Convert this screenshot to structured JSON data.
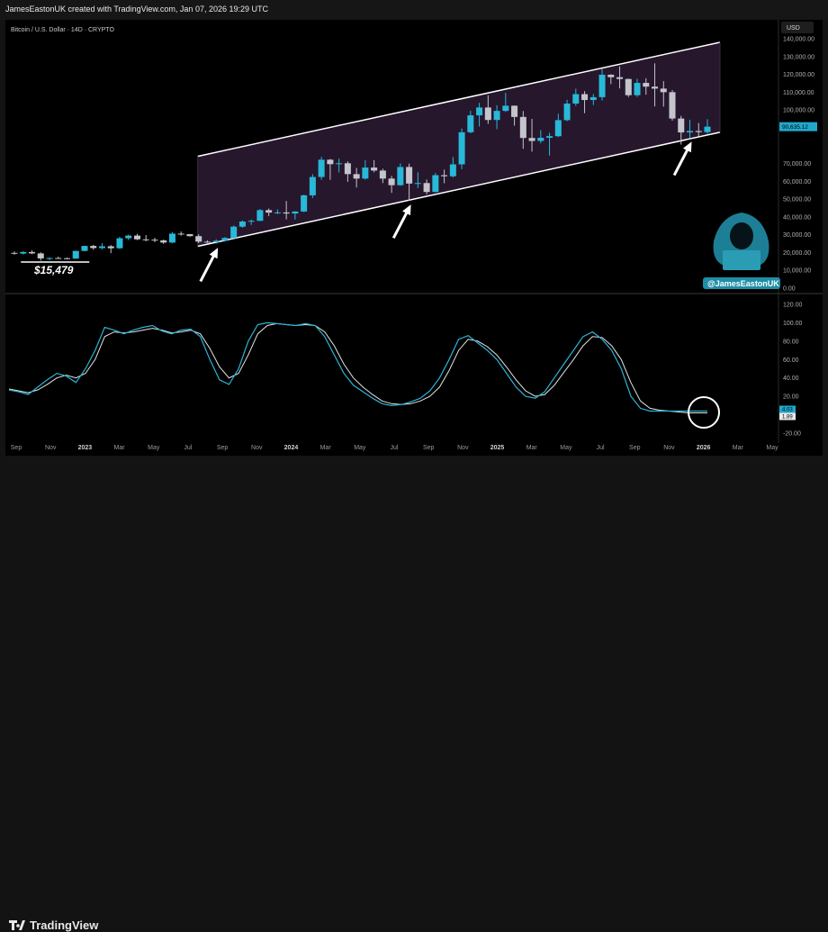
{
  "header": {
    "credit": "JamesEastonUK created with TradingView.com, Jan 07, 2026 19:29 UTC"
  },
  "footer": {
    "brand": "TradingView"
  },
  "chart_data": [
    {
      "type": "candlestick",
      "title": "Bitcoin / U.S. Dollar · 14D · CRYPTO",
      "currency": "USD",
      "ylim": [
        0,
        140000
      ],
      "y_ticks": [
        "140,000.00",
        "130,000.00",
        "120,000.00",
        "110,000.00",
        "100,000.00",
        "90,000.00",
        "70,000.00",
        "60,000.00",
        "50,000.00",
        "40,000.00",
        "30,000.00",
        "20,000.00",
        "10,000.00",
        "0.00"
      ],
      "last_price": "90,635.12",
      "annotation": "$15,479",
      "watermark_handle": "@JamesEastonUK",
      "colors": {
        "up": "#28b8d8",
        "down": "#c4c4cc",
        "channel_fill": "#2a1a32",
        "channel_line": "#ffffff"
      },
      "channel": {
        "upper": [
          [
            "2023-08",
            74000
          ],
          [
            "2026-01",
            138000
          ]
        ],
        "lower": [
          [
            "2023-08",
            23500
          ],
          [
            "2026-01",
            87500
          ]
        ]
      },
      "arrows_at": [
        "2023-09",
        "2024-08",
        "2025-12"
      ],
      "candles": [
        {
          "d": "2022-09",
          "o": 19800,
          "h": 20600,
          "l": 18800,
          "c": 19400
        },
        {
          "d": "2022-10",
          "o": 19400,
          "h": 20800,
          "l": 18900,
          "c": 20300
        },
        {
          "d": "2022-10b",
          "o": 20300,
          "h": 21200,
          "l": 19100,
          "c": 19500
        },
        {
          "d": "2022-11",
          "o": 19500,
          "h": 20100,
          "l": 15479,
          "c": 16700
        },
        {
          "d": "2022-11b",
          "o": 16700,
          "h": 17300,
          "l": 15700,
          "c": 16900
        },
        {
          "d": "2022-12",
          "o": 16900,
          "h": 17700,
          "l": 16500,
          "c": 16800
        },
        {
          "d": "2022-12b",
          "o": 16800,
          "h": 17200,
          "l": 16300,
          "c": 16600
        },
        {
          "d": "2023-01",
          "o": 16600,
          "h": 21000,
          "l": 16500,
          "c": 20900
        },
        {
          "d": "2023-01b",
          "o": 20900,
          "h": 23800,
          "l": 20600,
          "c": 23700
        },
        {
          "d": "2023-02",
          "o": 23700,
          "h": 24300,
          "l": 21500,
          "c": 22500
        },
        {
          "d": "2023-02b",
          "o": 22500,
          "h": 25200,
          "l": 21800,
          "c": 23500
        },
        {
          "d": "2023-03",
          "o": 23500,
          "h": 24200,
          "l": 19600,
          "c": 22400
        },
        {
          "d": "2023-03b",
          "o": 22400,
          "h": 28800,
          "l": 22000,
          "c": 28000
        },
        {
          "d": "2023-04",
          "o": 28000,
          "h": 30000,
          "l": 27000,
          "c": 29500
        },
        {
          "d": "2023-04b",
          "o": 29500,
          "h": 30500,
          "l": 27000,
          "c": 27400
        },
        {
          "d": "2023-05",
          "o": 27400,
          "h": 29800,
          "l": 26300,
          "c": 27200
        },
        {
          "d": "2023-05b",
          "o": 27200,
          "h": 28300,
          "l": 25800,
          "c": 26800
        },
        {
          "d": "2023-06",
          "o": 26800,
          "h": 27300,
          "l": 24800,
          "c": 25600
        },
        {
          "d": "2023-06b",
          "o": 25600,
          "h": 31400,
          "l": 25200,
          "c": 30600
        },
        {
          "d": "2023-07",
          "o": 30600,
          "h": 31800,
          "l": 29500,
          "c": 30300
        },
        {
          "d": "2023-07b",
          "o": 30300,
          "h": 30400,
          "l": 28900,
          "c": 29200
        },
        {
          "d": "2023-08",
          "o": 29200,
          "h": 30200,
          "l": 25300,
          "c": 26100
        },
        {
          "d": "2023-08b",
          "o": 26100,
          "h": 26800,
          "l": 25400,
          "c": 25900
        },
        {
          "d": "2023-09",
          "o": 25900,
          "h": 27400,
          "l": 24900,
          "c": 26600
        },
        {
          "d": "2023-09b",
          "o": 26600,
          "h": 28600,
          "l": 26200,
          "c": 28200
        },
        {
          "d": "2023-10",
          "o": 28200,
          "h": 35200,
          "l": 27200,
          "c": 34500
        },
        {
          "d": "2023-10b",
          "o": 34500,
          "h": 38000,
          "l": 33900,
          "c": 37400
        },
        {
          "d": "2023-11",
          "o": 37400,
          "h": 38500,
          "l": 35500,
          "c": 37800
        },
        {
          "d": "2023-11b",
          "o": 37800,
          "h": 44400,
          "l": 37600,
          "c": 43800
        },
        {
          "d": "2023-12",
          "o": 43800,
          "h": 44700,
          "l": 40400,
          "c": 42400
        },
        {
          "d": "2023-12b",
          "o": 42400,
          "h": 44200,
          "l": 41600,
          "c": 42500
        },
        {
          "d": "2024-01",
          "o": 42500,
          "h": 48900,
          "l": 38600,
          "c": 41900
        },
        {
          "d": "2024-01b",
          "o": 41900,
          "h": 43200,
          "l": 38500,
          "c": 43000
        },
        {
          "d": "2024-02",
          "o": 43000,
          "h": 52500,
          "l": 42700,
          "c": 52100
        },
        {
          "d": "2024-02b",
          "o": 52100,
          "h": 64000,
          "l": 50600,
          "c": 62400
        },
        {
          "d": "2024-03",
          "o": 62400,
          "h": 73700,
          "l": 60800,
          "c": 72100
        },
        {
          "d": "2024-03b",
          "o": 72100,
          "h": 72500,
          "l": 60800,
          "c": 69600
        },
        {
          "d": "2024-04",
          "o": 69600,
          "h": 72700,
          "l": 65000,
          "c": 70100
        },
        {
          "d": "2024-04b",
          "o": 70100,
          "h": 71200,
          "l": 59700,
          "c": 64000
        },
        {
          "d": "2024-05",
          "o": 64000,
          "h": 67500,
          "l": 56500,
          "c": 61500
        },
        {
          "d": "2024-05b",
          "o": 61500,
          "h": 71900,
          "l": 60900,
          "c": 67700
        },
        {
          "d": "2024-06",
          "o": 67700,
          "h": 71900,
          "l": 65100,
          "c": 66000
        },
        {
          "d": "2024-06b",
          "o": 66000,
          "h": 67000,
          "l": 59000,
          "c": 61500
        },
        {
          "d": "2024-07",
          "o": 61500,
          "h": 63000,
          "l": 53500,
          "c": 57800
        },
        {
          "d": "2024-07b",
          "o": 57800,
          "h": 70000,
          "l": 57400,
          "c": 68000
        },
        {
          "d": "2024-08",
          "o": 68000,
          "h": 69900,
          "l": 49000,
          "c": 58700
        },
        {
          "d": "2024-08b",
          "o": 58700,
          "h": 65000,
          "l": 56200,
          "c": 59000
        },
        {
          "d": "2024-09",
          "o": 59000,
          "h": 61000,
          "l": 52600,
          "c": 54000
        },
        {
          "d": "2024-09b",
          "o": 54000,
          "h": 64600,
          "l": 53700,
          "c": 63400
        },
        {
          "d": "2024-10",
          "o": 63400,
          "h": 66500,
          "l": 58900,
          "c": 62800
        },
        {
          "d": "2024-10b",
          "o": 62800,
          "h": 73600,
          "l": 62100,
          "c": 69500
        },
        {
          "d": "2024-11",
          "o": 69500,
          "h": 89600,
          "l": 66800,
          "c": 87500
        },
        {
          "d": "2024-11b",
          "o": 87500,
          "h": 99600,
          "l": 86900,
          "c": 97000
        },
        {
          "d": "2024-12",
          "o": 97000,
          "h": 104000,
          "l": 90700,
          "c": 101400
        },
        {
          "d": "2024-12b",
          "o": 101400,
          "h": 108300,
          "l": 92200,
          "c": 94400
        },
        {
          "d": "2025-01",
          "o": 94400,
          "h": 102700,
          "l": 89200,
          "c": 99500
        },
        {
          "d": "2025-01b",
          "o": 99500,
          "h": 109600,
          "l": 98900,
          "c": 102400
        },
        {
          "d": "2025-02",
          "o": 102400,
          "h": 102500,
          "l": 91200,
          "c": 96100
        },
        {
          "d": "2025-02b",
          "o": 96100,
          "h": 99400,
          "l": 78200,
          "c": 84300
        },
        {
          "d": "2025-03",
          "o": 84300,
          "h": 95000,
          "l": 76600,
          "c": 82600
        },
        {
          "d": "2025-03b",
          "o": 82600,
          "h": 88700,
          "l": 81300,
          "c": 84400
        },
        {
          "d": "2025-04",
          "o": 84400,
          "h": 87200,
          "l": 74400,
          "c": 85300
        },
        {
          "d": "2025-04b",
          "o": 85300,
          "h": 97900,
          "l": 84800,
          "c": 94300
        },
        {
          "d": "2025-05",
          "o": 94300,
          "h": 105700,
          "l": 93700,
          "c": 103600
        },
        {
          "d": "2025-05b",
          "o": 103600,
          "h": 111900,
          "l": 102300,
          "c": 108900
        },
        {
          "d": "2025-06",
          "o": 108900,
          "h": 110600,
          "l": 98200,
          "c": 105600
        },
        {
          "d": "2025-06b",
          "o": 105600,
          "h": 109000,
          "l": 102800,
          "c": 107200
        },
        {
          "d": "2025-07",
          "o": 107200,
          "h": 123200,
          "l": 105300,
          "c": 119800
        },
        {
          "d": "2025-07b",
          "o": 119800,
          "h": 120000,
          "l": 114500,
          "c": 118400
        },
        {
          "d": "2025-08",
          "o": 118400,
          "h": 124500,
          "l": 112100,
          "c": 117400
        },
        {
          "d": "2025-08b",
          "o": 117400,
          "h": 117600,
          "l": 107300,
          "c": 108300
        },
        {
          "d": "2025-09",
          "o": 108300,
          "h": 117500,
          "l": 107300,
          "c": 115200
        },
        {
          "d": "2025-09b",
          "o": 115200,
          "h": 117800,
          "l": 108600,
          "c": 113100
        },
        {
          "d": "2025-10",
          "o": 113100,
          "h": 126200,
          "l": 102000,
          "c": 112000
        },
        {
          "d": "2025-10b",
          "o": 112000,
          "h": 116200,
          "l": 101900,
          "c": 110000
        },
        {
          "d": "2025-11",
          "o": 110000,
          "h": 111200,
          "l": 94000,
          "c": 95200
        },
        {
          "d": "2025-11b",
          "o": 95200,
          "h": 96700,
          "l": 80600,
          "c": 87400
        },
        {
          "d": "2025-12",
          "o": 87400,
          "h": 94500,
          "l": 84000,
          "c": 88200
        },
        {
          "d": "2025-12b",
          "o": 88200,
          "h": 92700,
          "l": 85200,
          "c": 87600
        },
        {
          "d": "2026-01",
          "o": 87600,
          "h": 94800,
          "l": 86700,
          "c": 90635
        }
      ]
    },
    {
      "type": "line",
      "title": "",
      "ylim": [
        -20,
        120
      ],
      "y_ticks": [
        "120.00",
        "100.00",
        "80.00",
        "60.00",
        "40.00",
        "20.00",
        "0.00",
        "-20.00"
      ],
      "last_values": [
        "4.03",
        "1.89"
      ],
      "x_ticks": [
        "Sep",
        "Nov",
        "2023",
        "Mar",
        "May",
        "Jul",
        "Sep",
        "Nov",
        "2024",
        "Mar",
        "May",
        "Jul",
        "Sep",
        "Nov",
        "2025",
        "Mar",
        "May",
        "Jul",
        "Sep",
        "Nov",
        "2026",
        "Mar",
        "May"
      ],
      "colors": {
        "k": "#2bb5d8",
        "d": "#e4e4e4"
      },
      "series": [
        {
          "name": "",
          "values": [
            27,
            25,
            22,
            30,
            38,
            45,
            42,
            35,
            50,
            70,
            95,
            92,
            88,
            92,
            95,
            97,
            91,
            88,
            92,
            93,
            85,
            60,
            38,
            33,
            50,
            80,
            98,
            100,
            99,
            98,
            97,
            99,
            97,
            85,
            65,
            45,
            32,
            25,
            18,
            12,
            10,
            11,
            14,
            18,
            26,
            40,
            60,
            82,
            86,
            78,
            70,
            60,
            45,
            30,
            20,
            18,
            25,
            40,
            55,
            70,
            85,
            90,
            82,
            70,
            50,
            20,
            7,
            4,
            4,
            4,
            4,
            4,
            4,
            4
          ]
        },
        {
          "name": "",
          "values": [
            28,
            26,
            24,
            27,
            33,
            40,
            43,
            40,
            45,
            60,
            85,
            90,
            89,
            90,
            92,
            94,
            92,
            89,
            90,
            92,
            88,
            72,
            52,
            40,
            45,
            65,
            88,
            97,
            99,
            98,
            97,
            98,
            97,
            90,
            75,
            55,
            40,
            30,
            22,
            15,
            12,
            11,
            12,
            15,
            20,
            30,
            48,
            70,
            82,
            80,
            74,
            65,
            52,
            38,
            26,
            20,
            22,
            32,
            46,
            60,
            75,
            85,
            84,
            75,
            60,
            35,
            15,
            7,
            5,
            4,
            3,
            2,
            2,
            2
          ]
        }
      ]
    }
  ]
}
